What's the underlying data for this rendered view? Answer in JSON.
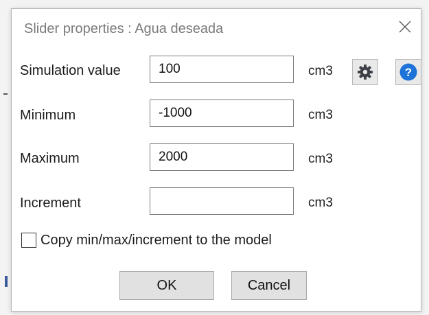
{
  "dialog": {
    "title": "Slider properties : Agua deseada",
    "close_glyph": "×"
  },
  "fields": [
    {
      "label": "Simulation value",
      "value": "100",
      "unit": "cm3"
    },
    {
      "label": "Minimum",
      "value": "-1000",
      "unit": "cm3"
    },
    {
      "label": "Maximum",
      "value": "2000",
      "unit": "cm3"
    },
    {
      "label": "Increment",
      "value": "",
      "unit": "cm3"
    }
  ],
  "icons": {
    "settings": "gear-icon",
    "help": "help-icon",
    "help_glyph": "?",
    "help_color": "#1e73d8"
  },
  "checkbox": {
    "label": "Copy min/max/increment to the model",
    "checked": false
  },
  "buttons": {
    "ok": "OK",
    "cancel": "Cancel"
  }
}
